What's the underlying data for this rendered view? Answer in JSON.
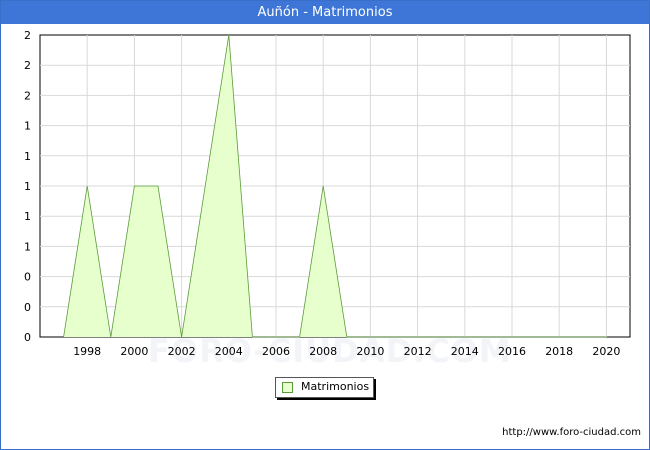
{
  "header": {
    "title": "Auñón - Matrimonios"
  },
  "chart_data": {
    "type": "area",
    "title": "Auñón - Matrimonios",
    "x": [
      1997,
      1998,
      1999,
      2000,
      2001,
      2002,
      2003,
      2004,
      2005,
      2006,
      2007,
      2008,
      2009,
      2010,
      2011,
      2012,
      2013,
      2014,
      2015,
      2016,
      2017,
      2018,
      2019,
      2020
    ],
    "series": [
      {
        "name": "Matrimonios",
        "values": [
          0,
          1,
          0,
          1,
          1,
          0,
          1,
          2,
          0,
          0,
          0,
          1,
          0,
          0,
          0,
          0,
          0,
          0,
          0,
          0,
          0,
          0,
          0,
          0
        ]
      }
    ],
    "xlim": [
      1996.0,
      2021.0
    ],
    "ylim": [
      0,
      2
    ],
    "x_ticks": [
      "1998",
      "2000",
      "2002",
      "2004",
      "2006",
      "2008",
      "2010",
      "2012",
      "2014",
      "2016",
      "2018",
      "2020"
    ],
    "y_ticks": [
      "0",
      "0",
      "0",
      "1",
      "1",
      "1",
      "1",
      "1",
      "2",
      "2",
      "2"
    ],
    "grid": true,
    "legend_position": "bottom",
    "fill_color": "#e6ffcc",
    "line_color": "#5a9a3a"
  },
  "footer": {
    "url": "http://www.foro-ciudad.com"
  },
  "watermark": {
    "text": "FORO-CIUDAD.COM"
  }
}
